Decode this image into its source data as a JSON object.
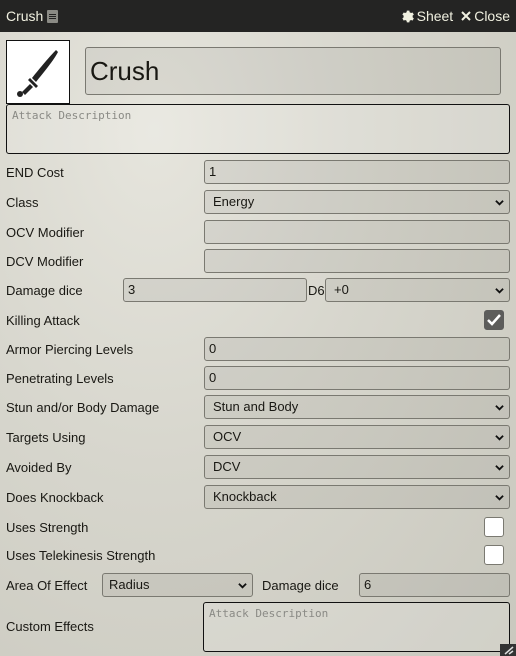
{
  "window": {
    "title": "Crush",
    "controls": {
      "sheet_label": "Sheet",
      "close_label": "Close"
    }
  },
  "header": {
    "name": "Crush",
    "description_placeholder": "Attack Description"
  },
  "fields": {
    "end_cost": {
      "label": "END Cost",
      "value": "1"
    },
    "class": {
      "label": "Class",
      "value": "Energy"
    },
    "ocv_modifier": {
      "label": "OCV Modifier",
      "value": ""
    },
    "dcv_modifier": {
      "label": "DCV Modifier",
      "value": ""
    },
    "damage_dice": {
      "label": "Damage dice",
      "value": "3",
      "suffix": "D6",
      "plus": "+0"
    },
    "killing_attack": {
      "label": "Killing Attack",
      "checked": true
    },
    "armor_piercing": {
      "label": "Armor Piercing Levels",
      "value": "0"
    },
    "penetrating": {
      "label": "Penetrating Levels",
      "value": "0"
    },
    "stun_body": {
      "label": "Stun and/or Body Damage",
      "value": "Stun and Body"
    },
    "targets_using": {
      "label": "Targets Using",
      "value": "OCV"
    },
    "avoided_by": {
      "label": "Avoided By",
      "value": "DCV"
    },
    "knockback": {
      "label": "Does Knockback",
      "value": "Knockback"
    },
    "uses_strength": {
      "label": "Uses Strength",
      "checked": false
    },
    "uses_tk_strength": {
      "label": "Uses Telekinesis Strength",
      "checked": false
    },
    "area_of_effect": {
      "label": "Area Of Effect",
      "value": "Radius",
      "dice_label": "Damage dice",
      "dice_value": "6"
    },
    "custom_effects": {
      "label": "Custom Effects",
      "placeholder": "Attack Description"
    }
  }
}
